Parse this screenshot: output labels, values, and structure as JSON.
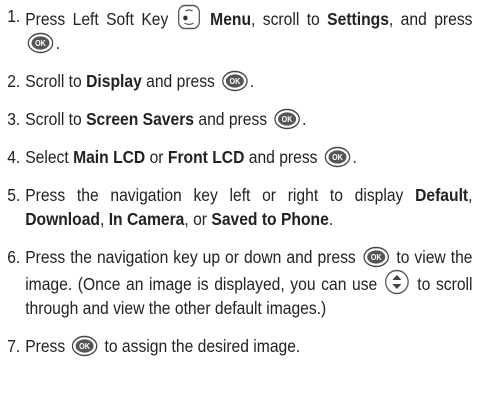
{
  "icons": {
    "left_soft_key": "left-soft-key-icon",
    "ok": "ok-key-icon",
    "navigation_up_down": "up-down-navigation-key-icon"
  },
  "ok_label": "OK",
  "steps": [
    {
      "number": "1.",
      "t1": "Press Left Soft Key",
      "b1": "Menu",
      "t2": ", scroll to",
      "b2": "Settings",
      "t3": ", and press",
      "t4": "."
    },
    {
      "number": "2.",
      "t1": "Scroll to",
      "b1": "Display",
      "t2": "and press",
      "t3": "."
    },
    {
      "number": "3.",
      "t1": "Scroll to",
      "b1": "Screen Savers",
      "t2": "and press",
      "t3": "."
    },
    {
      "number": "4.",
      "t1": "Select",
      "b1": "Main LCD",
      "t2": "or",
      "b2": "Front LCD",
      "t3": "and press",
      "t4": "."
    },
    {
      "number": "5.",
      "t1": "Press the navigation key left or right to display",
      "b1": "Default",
      "t2": ",",
      "b2": "Download",
      "t3": ",",
      "b3": "In Camera",
      "t4": ", or",
      "b4": "Saved to Phone",
      "t5": "."
    },
    {
      "number": "6.",
      "t1": "Press the navigation key up or down and press",
      "t2": "to view the image. (Once an image is displayed, you can use",
      "t3": "to scroll through and view the other default images.)"
    },
    {
      "number": "7.",
      "t1": "Press",
      "t2": "to assign the desired image."
    }
  ]
}
